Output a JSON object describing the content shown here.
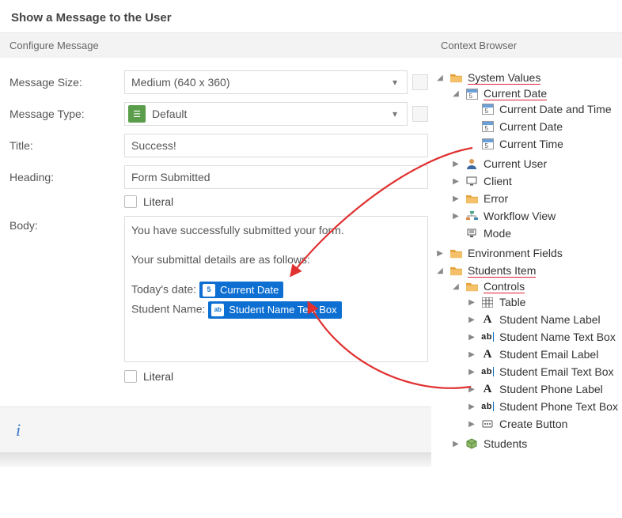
{
  "page_title": "Show a Message to the User",
  "left": {
    "header": "Configure Message",
    "rows": {
      "size_label": "Message Size:",
      "size_value": "Medium (640 x 360)",
      "type_label": "Message Type:",
      "type_value": "Default",
      "title_label": "Title:",
      "title_value": "Success!",
      "heading_label": "Heading:",
      "heading_value": "Form Submitted",
      "body_label": "Body:"
    },
    "literal_label": "Literal",
    "body": {
      "line1": "You have successfully submitted your form.",
      "line2": "Your submittal details are as follows:",
      "today_label": "Today's date:",
      "today_token": "Current Date",
      "student_label": "Student Name:",
      "student_token": "Student Name Text Box"
    },
    "info_icon": "i"
  },
  "right": {
    "header": "Context Browser",
    "tree": {
      "system_values": "System Values",
      "current_date_node": "Current Date",
      "current_date_time": "Current Date and Time",
      "current_date": "Current Date",
      "current_time": "Current Time",
      "current_user": "Current User",
      "client": "Client",
      "error": "Error",
      "workflow_view": "Workflow View",
      "mode": "Mode",
      "env_fields": "Environment Fields",
      "students_item": "Students Item",
      "controls": "Controls",
      "table": "Table",
      "student_name_label": "Student Name Label",
      "student_name_textbox": "Student Name Text Box",
      "student_email_label": "Student Email Label",
      "student_email_textbox": "Student Email Text Box",
      "student_phone_label": "Student Phone Label",
      "student_phone_textbox": "Student Phone Text Box",
      "create_button": "Create Button",
      "students": "Students"
    }
  }
}
